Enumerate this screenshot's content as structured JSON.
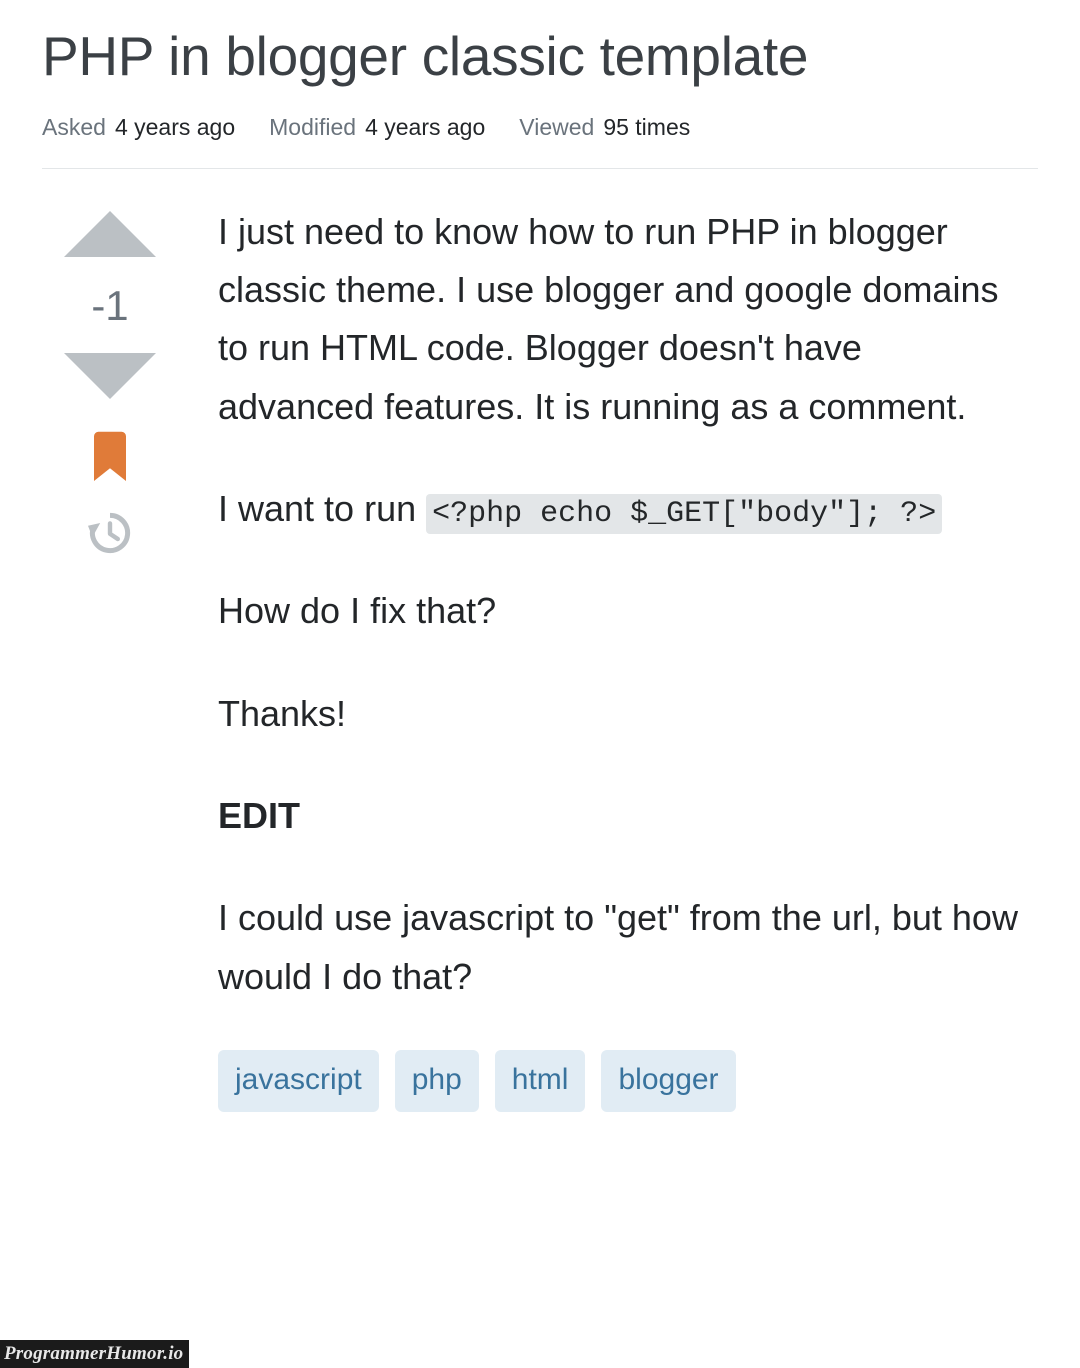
{
  "question": {
    "title": "PHP in blogger classic template",
    "meta": [
      {
        "label": "Asked",
        "value": "4 years ago"
      },
      {
        "label": "Modified",
        "value": "4 years ago"
      },
      {
        "label": "Viewed",
        "value": "95 times"
      }
    ]
  },
  "vote": {
    "score": "-1",
    "up_icon": "triangle-up-icon",
    "down_icon": "triangle-down-icon",
    "bookmark_icon": "bookmark-icon",
    "history_icon": "history-clock-icon",
    "arrow_color": "#bbc0c4",
    "bookmark_color": "#e07b39",
    "history_color": "#bbc0c4",
    "score_color": "#6a737c"
  },
  "body": {
    "paragraph1": "I just need to know how to run PHP in blogger classic theme. I use blogger and google domains to run HTML code. Blogger doesn't have advanced features. It is running as a comment.",
    "paragraph2_prefix": "I want to run ",
    "code_snippet": "<?php echo $_GET[\"body\"]; ?>",
    "paragraph3": "How do I fix that?",
    "paragraph4": "Thanks!",
    "edit_heading": "EDIT",
    "paragraph5": "I could use javascript to \"get\" from the url, but how would I do that?"
  },
  "tags": [
    {
      "label": "javascript"
    },
    {
      "label": "php"
    },
    {
      "label": "html"
    },
    {
      "label": "blogger"
    }
  ],
  "watermark": {
    "text": "ProgrammerHumor.io"
  },
  "colors": {
    "title": "#3b4045",
    "text": "#232629",
    "muted": "#6a737c",
    "code_bg": "#e3e6e8",
    "tag_bg": "#e1ecf4",
    "tag_text": "#39739d",
    "divider": "#e3e6e8"
  }
}
